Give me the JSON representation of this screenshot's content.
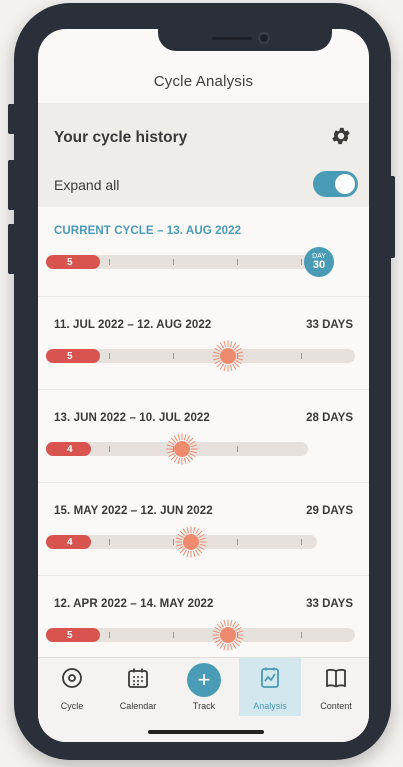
{
  "header": {
    "title": "Cycle Analysis"
  },
  "history": {
    "title": "Your cycle history",
    "expand_label": "Expand all",
    "expand_on": true
  },
  "current_cycle": {
    "label": "CURRENT CYCLE – 13. AUG 2022",
    "period_days": "5",
    "day_label": "DAY",
    "day_value": "30"
  },
  "cycles": [
    {
      "range": "11. JUL 2022 – 12. AUG 2022",
      "length": "33 DAYS",
      "period_days": "5"
    },
    {
      "range": "13. JUN 2022 – 10. JUL 2022",
      "length": "28 DAYS",
      "period_days": "4"
    },
    {
      "range": "15. MAY 2022 – 12. JUN 2022",
      "length": "29 DAYS",
      "period_days": "4"
    },
    {
      "range": "12. APR 2022 – 14. MAY 2022",
      "length": "33 DAYS",
      "period_days": "5"
    }
  ],
  "tabs": [
    {
      "label": "Cycle",
      "icon": "cycle-icon"
    },
    {
      "label": "Calendar",
      "icon": "calendar-icon"
    },
    {
      "label": "Track",
      "icon": "plus-icon"
    },
    {
      "label": "Analysis",
      "icon": "analysis-icon",
      "active": true
    },
    {
      "label": "Content",
      "icon": "book-icon"
    }
  ],
  "colors": {
    "accent": "#4a9bb6",
    "period": "#d9534f",
    "ovulation": "#f08a6e"
  }
}
